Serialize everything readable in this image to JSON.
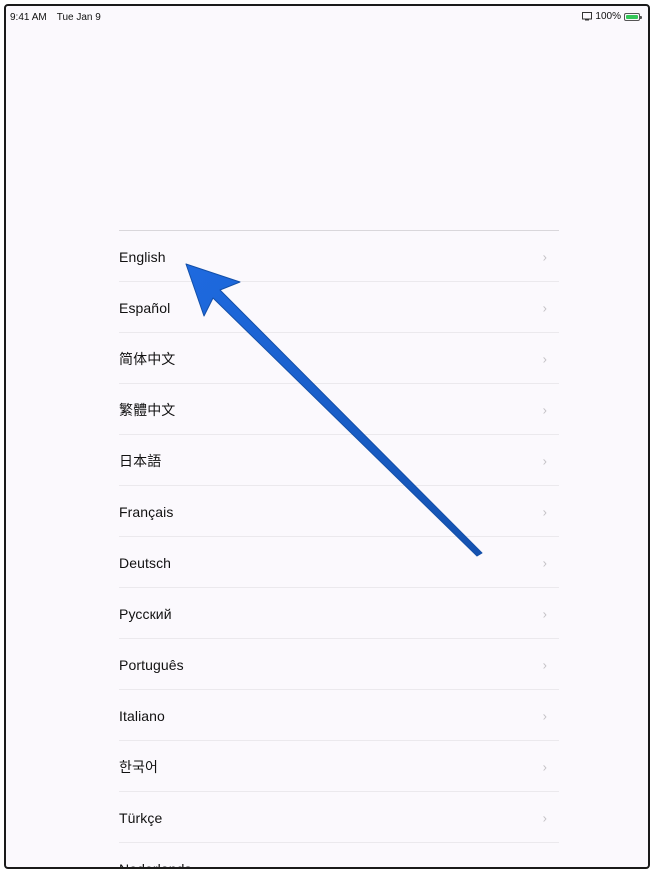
{
  "status_bar": {
    "time": "9:41 AM",
    "date": "Tue Jan 9",
    "battery": "100%",
    "wifi_icon": "wifi-icon",
    "battery_icon": "battery-icon"
  },
  "languages": [
    {
      "label": "English"
    },
    {
      "label": "Español"
    },
    {
      "label": "简体中文"
    },
    {
      "label": "繁體中文"
    },
    {
      "label": "日本語"
    },
    {
      "label": "Français"
    },
    {
      "label": "Deutsch"
    },
    {
      "label": "Русский"
    },
    {
      "label": "Português"
    },
    {
      "label": "Italiano"
    },
    {
      "label": "한국어"
    },
    {
      "label": "Türkçe"
    },
    {
      "label": "Nederlands"
    }
  ],
  "chevron": "›",
  "colors": {
    "arrow": "#1a5fc9",
    "battery": "#34c759",
    "background": "#fbf9fd"
  }
}
